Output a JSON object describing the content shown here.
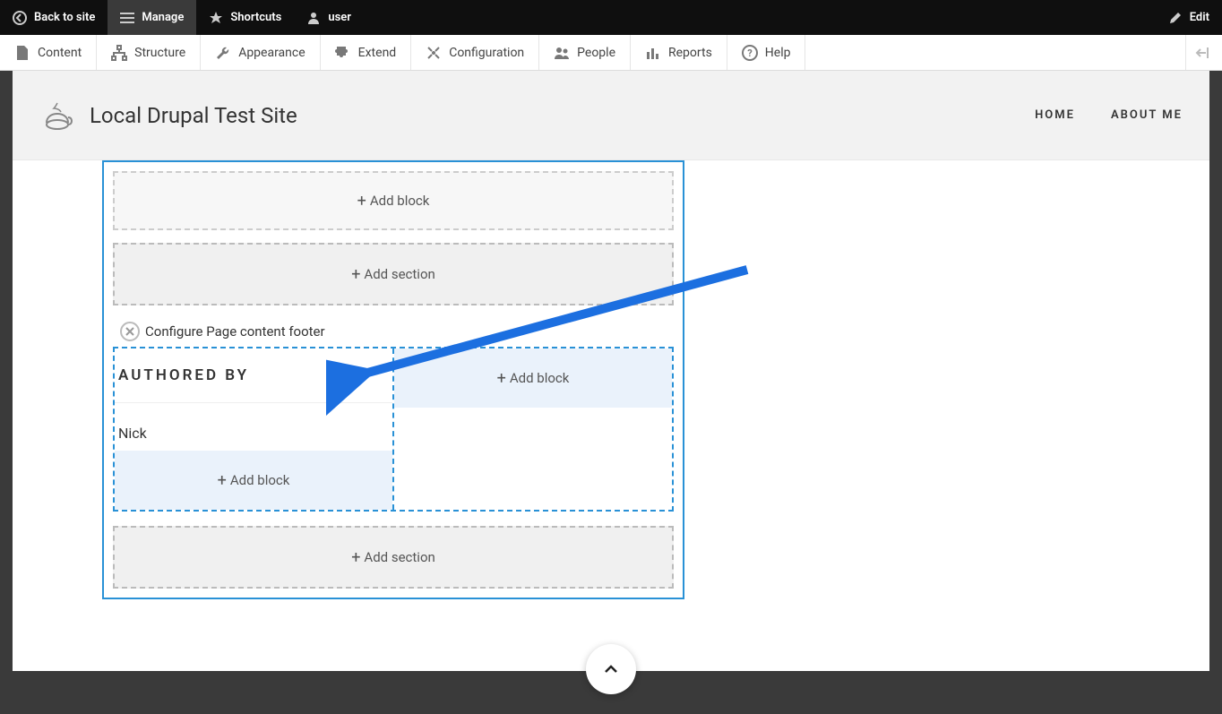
{
  "toolbar": {
    "back": "Back to site",
    "manage": "Manage",
    "shortcuts": "Shortcuts",
    "user": "user",
    "edit": "Edit"
  },
  "menu": {
    "content": "Content",
    "structure": "Structure",
    "appearance": "Appearance",
    "extend": "Extend",
    "configuration": "Configuration",
    "people": "People",
    "reports": "Reports",
    "help": "Help"
  },
  "site": {
    "title": "Local Drupal Test Site",
    "nav": {
      "home": "HOME",
      "about": "ABOUT ME"
    }
  },
  "layout": {
    "add_block": "Add block",
    "add_section": "Add section",
    "configure_label": "Configure Page content footer",
    "authored_by": "AUTHORED BY",
    "author_name": "Nick"
  }
}
